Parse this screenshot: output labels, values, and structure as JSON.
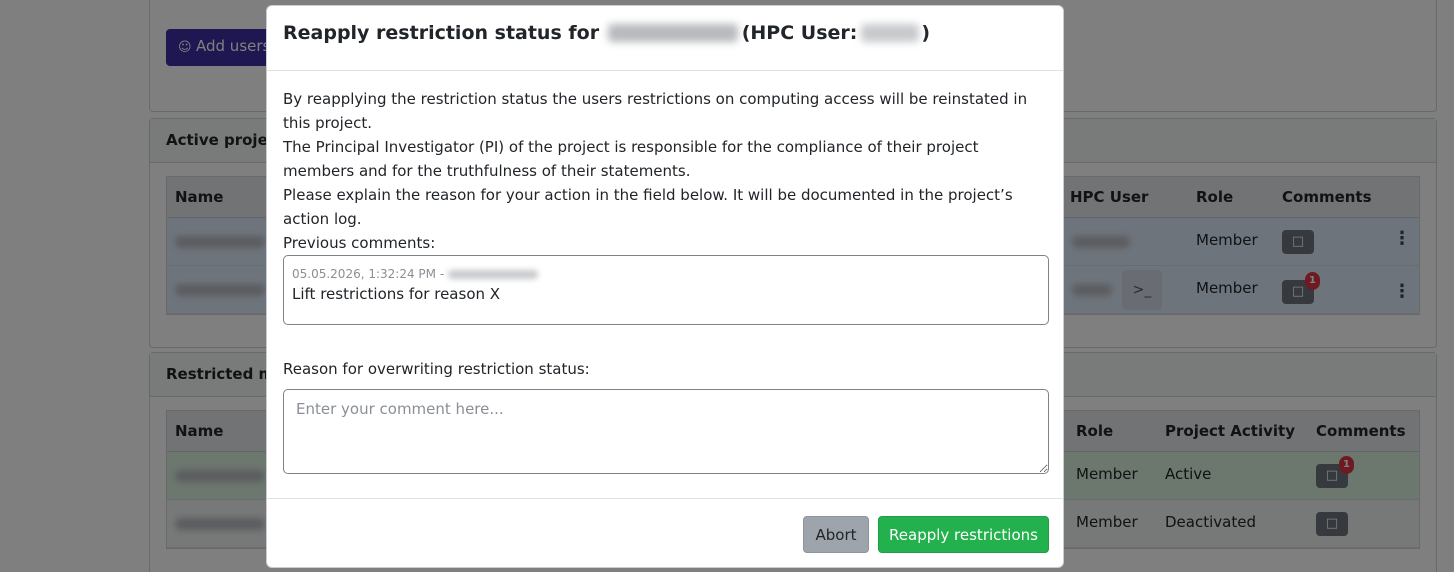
{
  "background": {
    "add_users_label": "Add users",
    "active_card_title": "Active project members",
    "active_table": {
      "headers": {
        "name": "Name",
        "hpc_user": "HPC User",
        "role": "Role",
        "comments": "Comments"
      },
      "rows": [
        {
          "role": "Member",
          "comment_badge": ""
        },
        {
          "role": "Member",
          "comment_badge": "1"
        }
      ]
    },
    "restricted_card_title": "Restricted members",
    "restricted_table": {
      "headers": {
        "name": "Name",
        "role": "Role",
        "activity": "Project Activity",
        "comments": "Comments"
      },
      "rows": [
        {
          "role": "Member",
          "activity": "Active",
          "comment_badge": "1"
        },
        {
          "role": "Member",
          "activity": "Deactivated",
          "comment_badge": ""
        }
      ]
    }
  },
  "modal": {
    "title_prefix": "Reapply restriction status for",
    "title_hpc_open": "(HPC User:",
    "title_hpc_close": ")",
    "paragraph_1": "By reapplying the restriction status the users restrictions on computing access will be reinstated in this project.",
    "paragraph_2": "The Principal Investigator (PI) of the project is responsible for the compliance of their project members and for the truthfulness of their statements.",
    "paragraph_3": "Please explain the reason for your action in the field below. It will be documented in the project’s action log.",
    "previous_comments_label": "Previous comments:",
    "previous_comment": {
      "timestamp": "05.05.2026, 1:32:24 PM -",
      "text": "Lift restrictions for reason X"
    },
    "reason_label": "Reason for overwriting restriction status:",
    "reason_placeholder": "Enter your comment here...",
    "abort_label": "Abort",
    "submit_label": "Reapply restrictions"
  },
  "icons": {
    "add_user": "person-plus-icon",
    "comment": "chat-bubble-icon",
    "more": "kebab-menu-icon",
    "terminal": "terminal-icon"
  },
  "colors": {
    "submit": "#22b14c",
    "abort": "#9ea4ab",
    "add_button": "#3f2ea3",
    "badge": "#dc3545"
  }
}
